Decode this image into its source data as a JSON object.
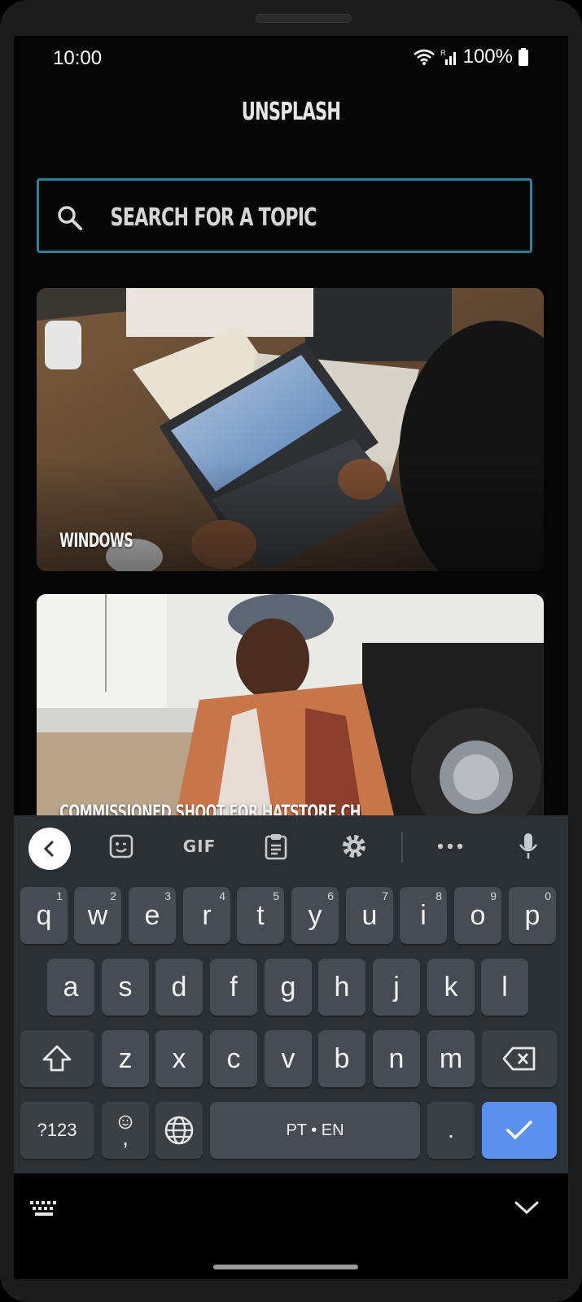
{
  "status_bar": {
    "time": "10:00",
    "battery": "100%",
    "icons": [
      "wifi-icon",
      "signal-icon",
      "battery-icon"
    ]
  },
  "app": {
    "title": "UNSPLASH"
  },
  "search": {
    "placeholder": "SEARCH FOR A TOPIC",
    "value": "",
    "border_color": "#2f7f95"
  },
  "topics": [
    {
      "label": "WINDOWS"
    },
    {
      "label": "COMMISSIONED SHOOT FOR HATSTORE.CH"
    }
  ],
  "keyboard": {
    "toolbar": [
      "back-icon",
      "sticker-icon",
      "GIF",
      "clipboard-icon",
      "settings-icon",
      "more-icon",
      "mic-icon"
    ],
    "gif_label": "GIF",
    "row1": [
      {
        "k": "q",
        "h": "1"
      },
      {
        "k": "w",
        "h": "2"
      },
      {
        "k": "e",
        "h": "3"
      },
      {
        "k": "r",
        "h": "4"
      },
      {
        "k": "t",
        "h": "5"
      },
      {
        "k": "y",
        "h": "6"
      },
      {
        "k": "u",
        "h": "7"
      },
      {
        "k": "i",
        "h": "8"
      },
      {
        "k": "o",
        "h": "9"
      },
      {
        "k": "p",
        "h": "0"
      }
    ],
    "row2": [
      "a",
      "s",
      "d",
      "f",
      "g",
      "h",
      "j",
      "k",
      "l"
    ],
    "row3": [
      "z",
      "x",
      "c",
      "v",
      "b",
      "n",
      "m"
    ],
    "symbols_label": "?123",
    "emoji_comma": ",",
    "space_label": "PT • EN",
    "period": ".",
    "accent_color": "#5b8ff0"
  },
  "nav": {
    "icons": [
      "keyboard-icon",
      "chevron-down-icon"
    ]
  }
}
